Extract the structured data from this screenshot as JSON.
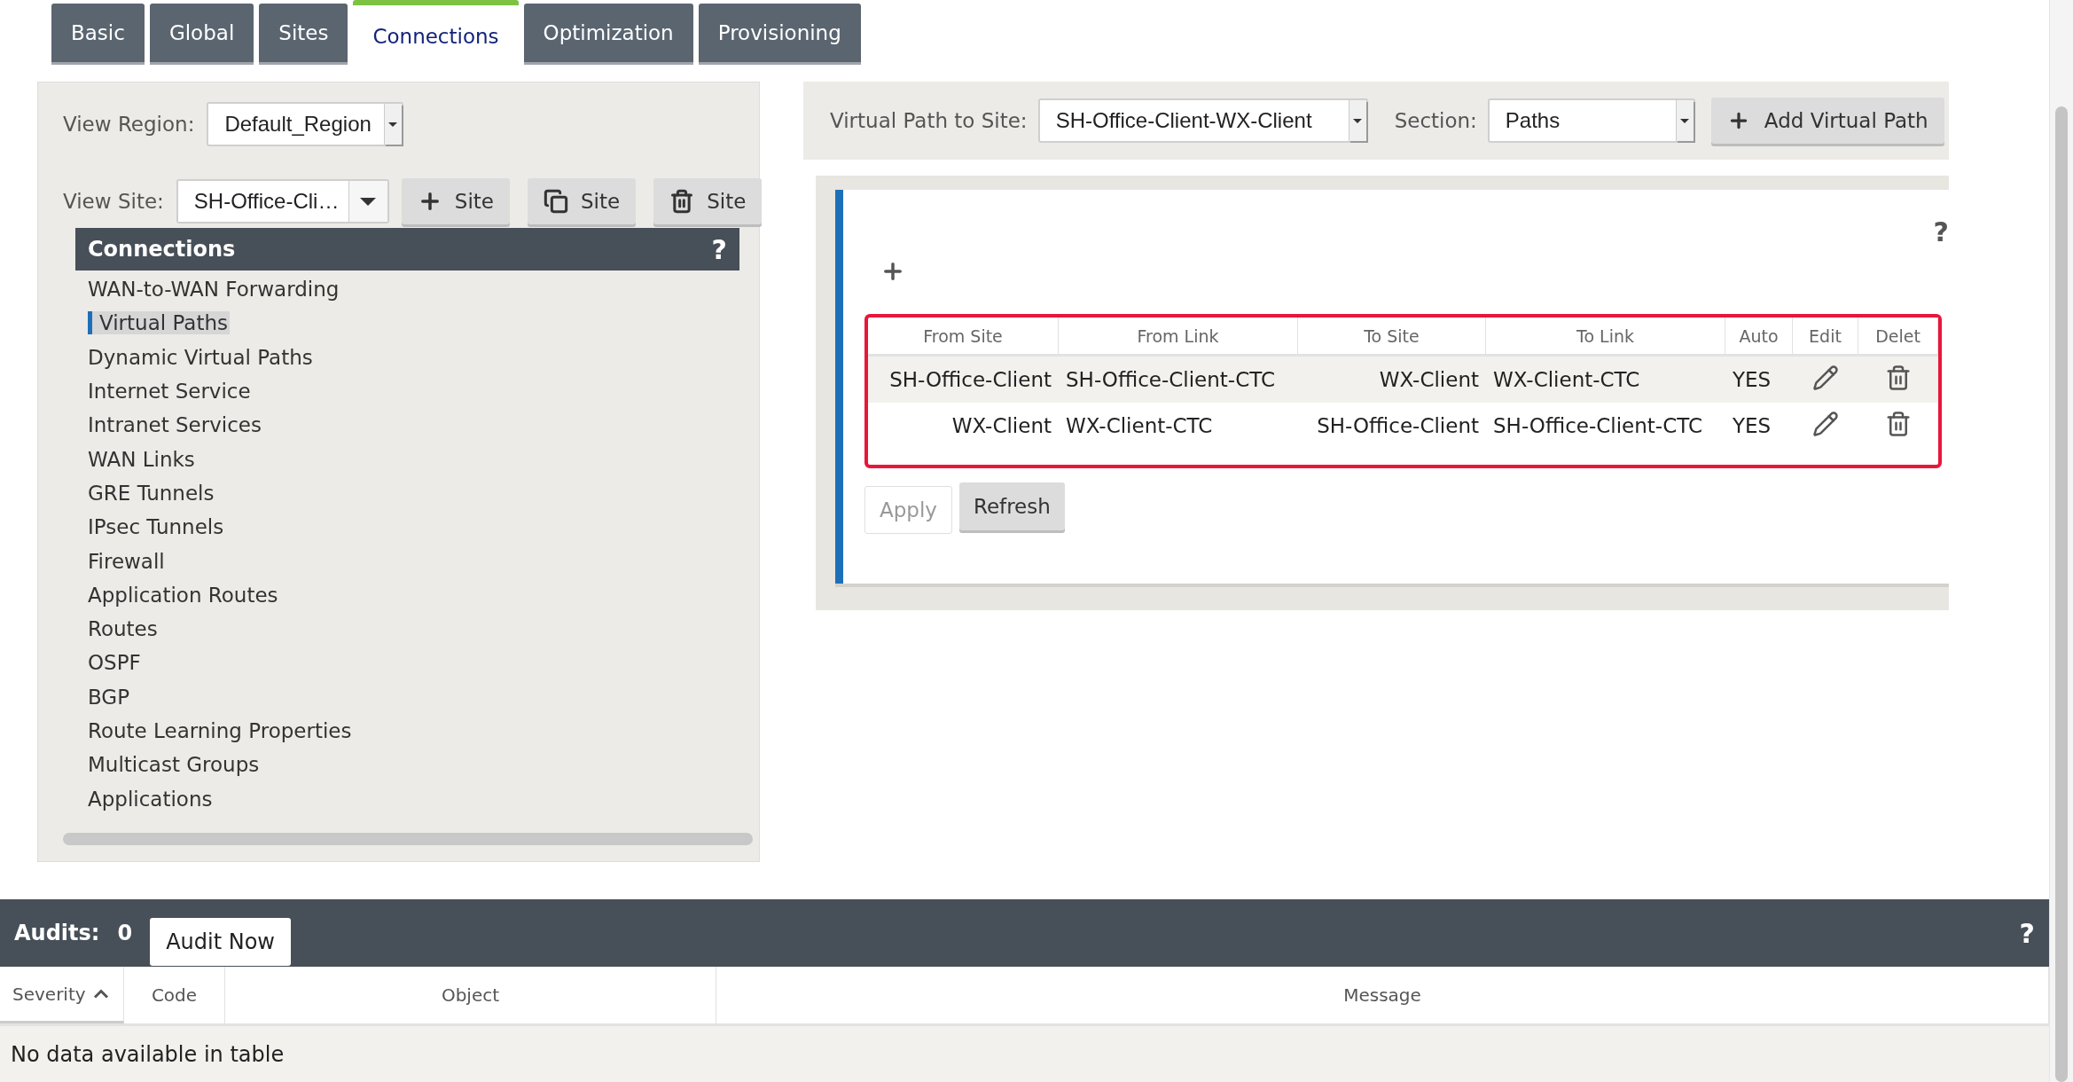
{
  "tabs": [
    {
      "label": "Basic",
      "selected": false
    },
    {
      "label": "Global",
      "selected": false
    },
    {
      "label": "Sites",
      "selected": false
    },
    {
      "label": "Connections",
      "selected": true
    },
    {
      "label": "Optimization",
      "selected": false
    },
    {
      "label": "Provisioning",
      "selected": false
    }
  ],
  "left_panel": {
    "view_region": {
      "label": "View Region:",
      "value": "Default_Region"
    },
    "view_site": {
      "label": "View Site:",
      "value": "SH-Office-Cli…"
    },
    "site_buttons": [
      {
        "kind": "add",
        "label": "Site"
      },
      {
        "kind": "copy",
        "label": "Site"
      },
      {
        "kind": "delete",
        "label": "Site"
      }
    ],
    "connections": {
      "title": "Connections",
      "help": "?",
      "items": [
        {
          "label": "WAN-to-WAN Forwarding",
          "selected": false
        },
        {
          "label": "Virtual Paths",
          "selected": true
        },
        {
          "label": "Dynamic Virtual Paths",
          "selected": false
        },
        {
          "label": "Internet Service",
          "selected": false
        },
        {
          "label": "Intranet Services",
          "selected": false
        },
        {
          "label": "WAN Links",
          "selected": false
        },
        {
          "label": "GRE Tunnels",
          "selected": false
        },
        {
          "label": "IPsec Tunnels",
          "selected": false
        },
        {
          "label": "Firewall",
          "selected": false
        },
        {
          "label": "Application Routes",
          "selected": false
        },
        {
          "label": "Routes",
          "selected": false
        },
        {
          "label": "OSPF",
          "selected": false
        },
        {
          "label": "BGP",
          "selected": false
        },
        {
          "label": "Route Learning Properties",
          "selected": false
        },
        {
          "label": "Multicast Groups",
          "selected": false
        },
        {
          "label": "Applications",
          "selected": false
        }
      ]
    }
  },
  "right_panel": {
    "virtual_path": {
      "label": "Virtual Path to Site:",
      "value": "SH-Office-Client-WX-Client"
    },
    "section": {
      "label": "Section:",
      "value": "Paths"
    },
    "add_button": {
      "label": "Add Virtual Path"
    },
    "help": "?",
    "table": {
      "columns": [
        "From Site",
        "From Link",
        "To Site",
        "To Link",
        "Auto",
        "Edit",
        "Delet"
      ],
      "rows": [
        {
          "from_site": "SH-Office-Client",
          "from_link": "SH-Office-Client-CTC",
          "to_site": "WX-Client",
          "to_link": "WX-Client-CTC",
          "auto": "YES"
        },
        {
          "from_site": "WX-Client",
          "from_link": "WX-Client-CTC",
          "to_site": "SH-Office-Client",
          "to_link": "SH-Office-Client-CTC",
          "auto": "YES"
        }
      ]
    },
    "buttons": [
      {
        "label": "Apply",
        "disabled": true
      },
      {
        "label": "Refresh",
        "disabled": false
      }
    ]
  },
  "audits": {
    "label": "Audits:",
    "count": "0",
    "button": "Audit Now",
    "help": "?",
    "columns": [
      {
        "label": "Severity",
        "sorted": true
      },
      {
        "label": "Code",
        "sorted": false
      },
      {
        "label": "Object",
        "sorted": false
      },
      {
        "label": "Message",
        "sorted": false
      }
    ],
    "empty": "No data available in table"
  }
}
